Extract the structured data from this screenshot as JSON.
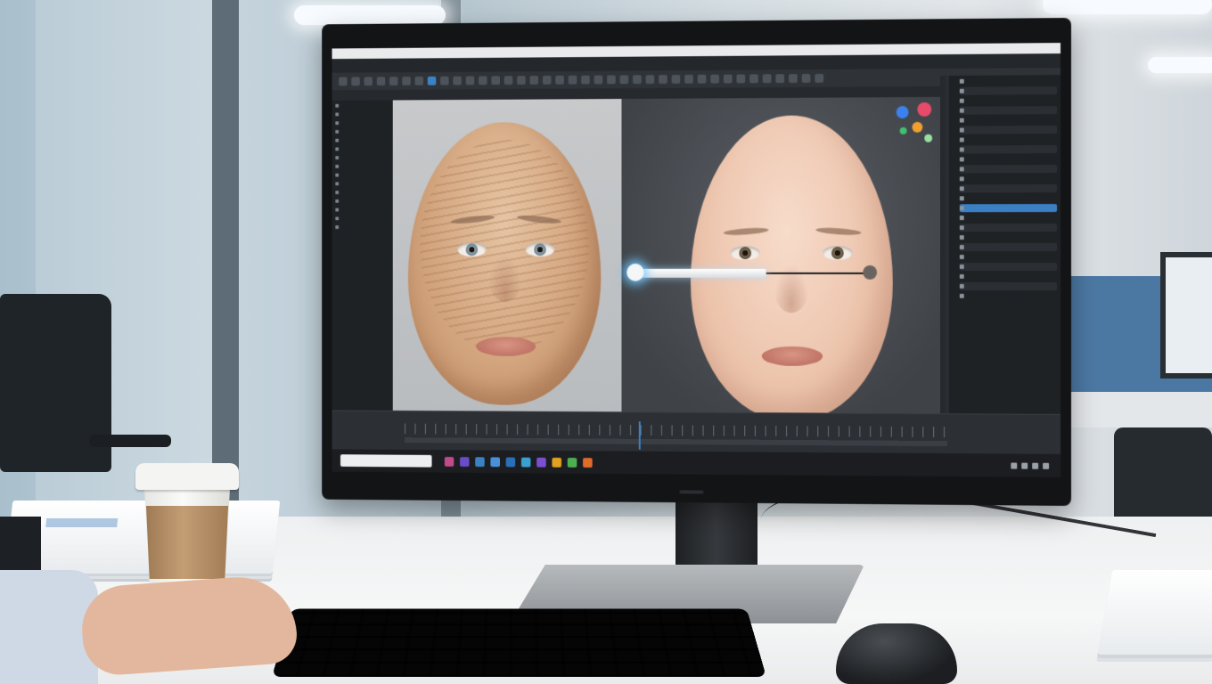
{
  "scene": {
    "description_colors": {
      "accent": "#3b82c4",
      "screen_bg": "#2b2e33",
      "partition_blue": "#4b78a3"
    }
  },
  "app": {
    "menu": [
      "",
      "",
      "",
      "",
      "",
      "",
      "",
      ""
    ],
    "tabs": [
      "",
      "",
      "",
      "",
      "",
      ""
    ],
    "active_tab": 2,
    "outliner": [
      "",
      "",
      "",
      "",
      "",
      "",
      "",
      "",
      "",
      "",
      "",
      "",
      "",
      "",
      ""
    ],
    "properties": [
      "",
      "",
      "",
      "",
      "",
      "",
      "",
      "",
      "",
      "",
      "",
      "",
      "",
      "",
      "",
      "",
      "",
      "",
      "",
      "",
      "",
      "",
      ""
    ],
    "selected_property": 13,
    "slider": {
      "value": 0.55
    },
    "taskbar_apps": [
      "#c04a8a",
      "#6a4cc8",
      "#3b82c4",
      "#4a8fd8",
      "#2a6fb8",
      "#39a0d0",
      "#7b4fd0",
      "#e0a020",
      "#4caf50",
      "#e06c2a"
    ],
    "clock": {
      "time": "",
      "date": ""
    }
  }
}
